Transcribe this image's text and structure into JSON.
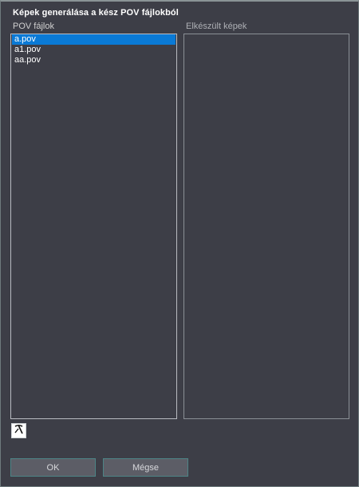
{
  "dialog": {
    "title": "Képek generálása a kész POV fájlokból"
  },
  "pov_list": {
    "label": "POV fájlok",
    "items": [
      {
        "label": "a.pov",
        "selected": true
      },
      {
        "label": "a1.pov",
        "selected": false
      },
      {
        "label": "aa.pov",
        "selected": false
      }
    ]
  },
  "images_panel": {
    "label": "Elkészült képek"
  },
  "toolbar": {
    "tool_icon": "pickaxe-icon"
  },
  "buttons": {
    "ok_label": "OK",
    "cancel_label": "Mégse"
  }
}
